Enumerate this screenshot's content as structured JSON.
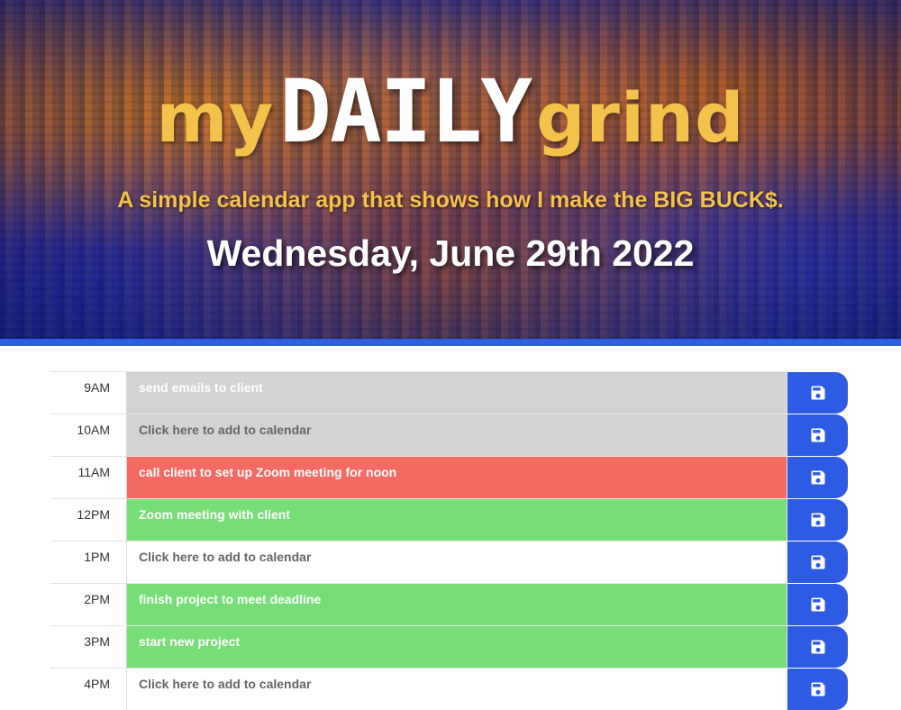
{
  "header": {
    "title_my": "my",
    "title_daily": "DAILY",
    "title_grind": "grind",
    "subtitle": "A simple calendar app that shows how I make the BIG BUCK$.",
    "date": "Wednesday, June 29th 2022"
  },
  "colors": {
    "accent_gold": "#f3c24b",
    "bar_blue": "#2f5ee0",
    "past_gray": "#d3d3d3",
    "present_red": "#f26a62",
    "future_green": "#77dd77",
    "save_blue": "#2e5be3"
  },
  "rows": [
    {
      "hour": "9AM",
      "text": "send emails to client",
      "state": "past"
    },
    {
      "hour": "10AM",
      "text": "Click here to add to calendar",
      "state": "past-empty"
    },
    {
      "hour": "11AM",
      "text": "call client to set up Zoom meeting for noon",
      "state": "present"
    },
    {
      "hour": "12PM",
      "text": "Zoom meeting with client",
      "state": "future"
    },
    {
      "hour": "1PM",
      "text": "Click here to add to calendar",
      "state": "empty"
    },
    {
      "hour": "2PM",
      "text": "finish project to meet deadline",
      "state": "future"
    },
    {
      "hour": "3PM",
      "text": "start new project",
      "state": "future"
    },
    {
      "hour": "4PM",
      "text": "Click here to add to calendar",
      "state": "empty"
    }
  ],
  "icons": {
    "save": "floppy-disk-icon"
  }
}
